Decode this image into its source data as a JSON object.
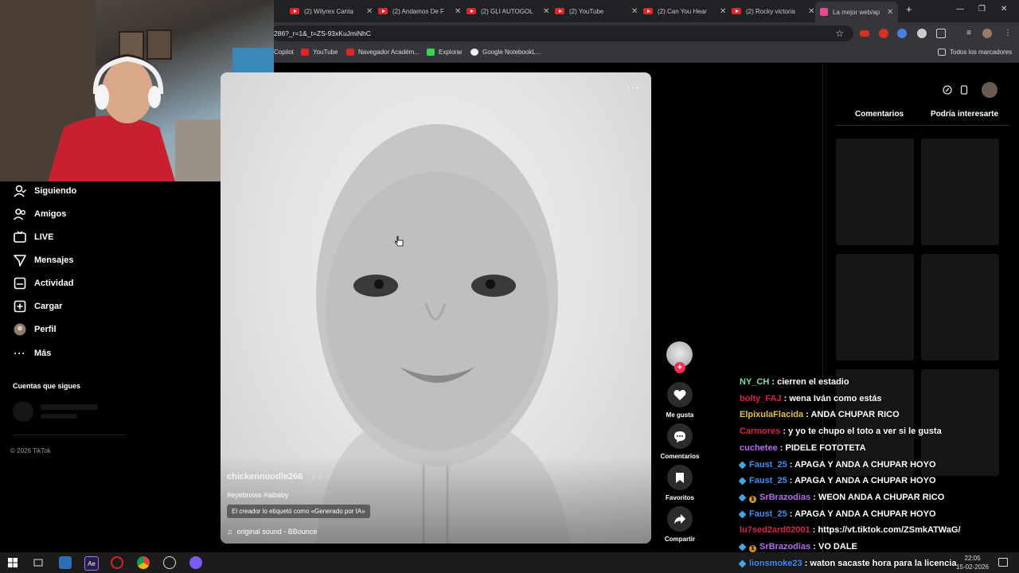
{
  "browser": {
    "tabs": [
      {
        "label": "(2) Wilyrex Canta",
        "icon": "youtube-icon"
      },
      {
        "label": "(2) Andamos De F",
        "icon": "youtube-icon"
      },
      {
        "label": "(2) GLI AUTOGOL",
        "icon": "youtube-icon"
      },
      {
        "label": "(2) YouTube",
        "icon": "youtube-icon"
      },
      {
        "label": "(2) Can You Hear",
        "icon": "youtube-icon"
      },
      {
        "label": "(2) Rocky victoria",
        "icon": "youtube-icon"
      },
      {
        "label": "La mejor web/ap",
        "icon": "tiktok-icon"
      }
    ],
    "new_tab": "+",
    "url": "286?_r=1&_t=ZS-93xKuJmiNhC",
    "bookmarks": [
      "Copilot",
      "YouTube",
      "Navegador Académ...",
      "Explorar",
      "Google NotebookL..."
    ],
    "all_bookmarks": "Todos los marcadores"
  },
  "sidebar": {
    "items": [
      {
        "label": "Siguiendo",
        "icon": "following-icon"
      },
      {
        "label": "Amigos",
        "icon": "friends-icon"
      },
      {
        "label": "LIVE",
        "icon": "live-icon"
      },
      {
        "label": "Mensajes",
        "icon": "messages-icon"
      },
      {
        "label": "Actividad",
        "icon": "activity-icon"
      },
      {
        "label": "Cargar",
        "icon": "upload-icon"
      },
      {
        "label": "Perfil",
        "icon": "profile-icon"
      },
      {
        "label": "Más",
        "icon": "more-icon"
      }
    ],
    "following_title": "Cuentas que sigues",
    "copyright": "© 2026 TikTok"
  },
  "video": {
    "username": "chickennoodle266",
    "date": "· 2-2",
    "hashtags": "#eyebrows #aibaby",
    "ai_label": "El creador lo etiquetó como «Generado por IA»",
    "music": "original sound - BBounce",
    "more": "···"
  },
  "actions": {
    "like": "Me gusta",
    "comments": "Comentarios",
    "favorites": "Favoritos",
    "share": "Compartir",
    "follow_plus": "+"
  },
  "right_panel": {
    "tab_comments": "Comentarios",
    "tab_interest": "Podría interesarte"
  },
  "chat": [
    {
      "user": "NY_CH",
      "color": "#7ee0a5",
      "text": ": cierren el estadio",
      "badge": ""
    },
    {
      "user": "bolty_FAJ",
      "color": "#d8234b",
      "text": ": wena Iván como estás",
      "badge": ""
    },
    {
      "user": "ElpixulaFlacida",
      "color": "#e7c04c",
      "text": ": ANDA CHUPAR RICO",
      "badge": ""
    },
    {
      "user": "Carmores",
      "color": "#d8234b",
      "text": ": y yo te chupo el toto a ver si le gusta",
      "badge": ""
    },
    {
      "user": "cuchetee",
      "color": "#b36cf0",
      "text": ": PIDELE FOTOTETA",
      "badge": ""
    },
    {
      "user": "Faust_25",
      "color": "#3f8ef5",
      "text": ": APAGA Y ANDA A CHUPAR HOYO",
      "badge": "hex"
    },
    {
      "user": "Faust_25",
      "color": "#3f8ef5",
      "text": ": APAGA Y ANDA A CHUPAR HOYO",
      "badge": "hex"
    },
    {
      "user": "SrBrazodias",
      "color": "#b36cf0",
      "text": ": WEON ANDA A CHUPAR RICO",
      "badge": "hex1"
    },
    {
      "user": "Faust_25",
      "color": "#3f8ef5",
      "text": ": APAGA Y ANDA A CHUPAR HOYO",
      "badge": "hex"
    },
    {
      "user": "lu7sed2ard02001",
      "color": "#d8234b",
      "text": ": https://vt.tiktok.com/ZSmkATWaG/",
      "badge": ""
    },
    {
      "user": "SrBrazodias",
      "color": "#b36cf0",
      "text": ": VO DALE",
      "badge": "hex1"
    },
    {
      "user": "lionsmoke23",
      "color": "#3f8ef5",
      "text": ": waton sacaste hora para la licencia",
      "badge": "hex"
    }
  ],
  "taskbar": {
    "time": "22:05",
    "date": "15-02-2026"
  }
}
